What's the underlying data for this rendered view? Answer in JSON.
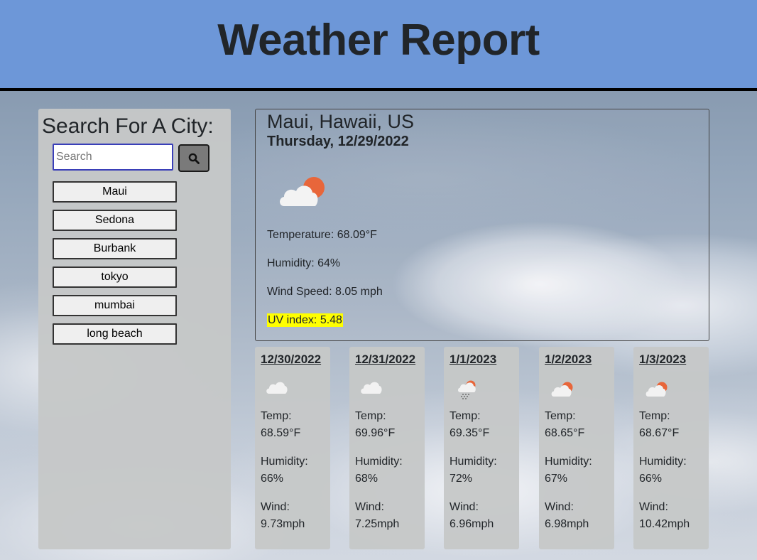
{
  "header": {
    "title": "Weather Report"
  },
  "search": {
    "heading": "Search For A City:",
    "placeholder": "Search",
    "value": ""
  },
  "history": [
    "Maui",
    "Sedona",
    "Burbank",
    "tokyo",
    "mumbai",
    "long beach"
  ],
  "current": {
    "city": "Maui, Hawaii, US",
    "date": "Thursday, 12/29/2022",
    "icon": "partly-cloudy-icon",
    "temperature": "Temperature: 68.09°F",
    "humidity": "Humidity: 64%",
    "wind": "Wind Speed: 8.05 mph",
    "uv": "UV index: 5.48",
    "uv_color": "#ffff00"
  },
  "forecast": [
    {
      "date": "12/30/2022",
      "icon": "cloud-icon",
      "temp_label": "Temp:",
      "temp": "68.59°F",
      "humidity_label": "Humidity:",
      "humidity": "66%",
      "wind_label": "Wind:",
      "wind": "9.73mph"
    },
    {
      "date": "12/31/2022",
      "icon": "cloud-icon",
      "temp_label": "Temp:",
      "temp": "69.96°F",
      "humidity_label": "Humidity:",
      "humidity": "68%",
      "wind_label": "Wind:",
      "wind": "7.25mph"
    },
    {
      "date": "1/1/2023",
      "icon": "rain-cloud-sun-icon",
      "temp_label": "Temp:",
      "temp": "69.35°F",
      "humidity_label": "Humidity:",
      "humidity": "72%",
      "wind_label": "Wind:",
      "wind": "6.96mph"
    },
    {
      "date": "1/2/2023",
      "icon": "partly-cloudy-icon",
      "temp_label": "Temp:",
      "temp": "68.65°F",
      "humidity_label": "Humidity:",
      "humidity": "67%",
      "wind_label": "Wind:",
      "wind": "6.98mph"
    },
    {
      "date": "1/3/2023",
      "icon": "partly-cloudy-icon",
      "temp_label": "Temp:",
      "temp": "68.67°F",
      "humidity_label": "Humidity:",
      "humidity": "66%",
      "wind_label": "Wind:",
      "wind": "10.42mph"
    }
  ],
  "colors": {
    "header_bg": "#6d97d8",
    "sun": "#e8663a",
    "panel_bg": "#c6c8c8",
    "uv_highlight": "#ffff00"
  }
}
